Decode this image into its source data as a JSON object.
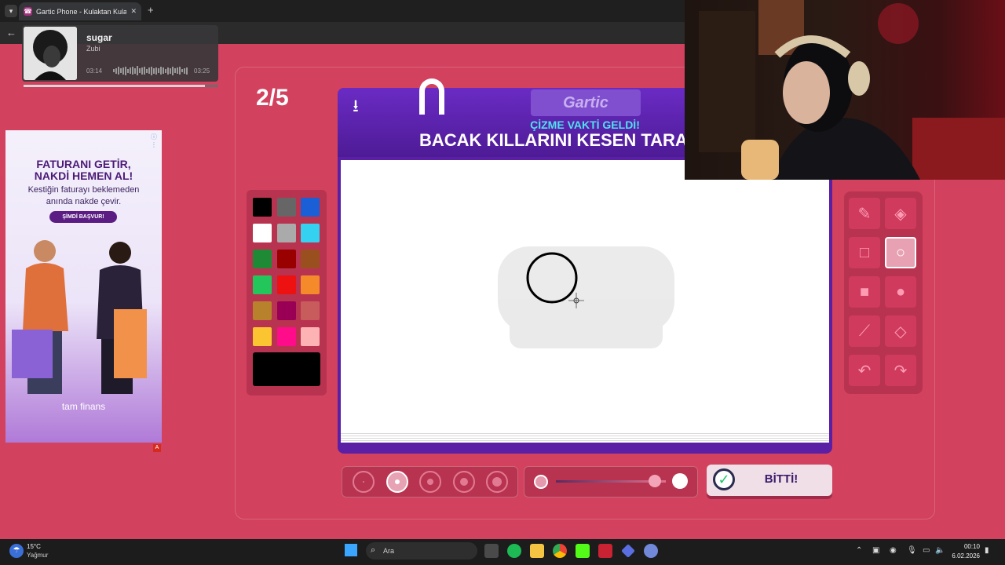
{
  "browser": {
    "tab_title": "Gartic Phone - Kulaktan Kulağa",
    "new_tab_icon": "+",
    "close_icon": "✕"
  },
  "music": {
    "title": "sugar",
    "artist": "Zubi",
    "current_time": "03:14",
    "total_time": "03:25",
    "progress": 0.93
  },
  "ad": {
    "headline": "FATURANI GETİR,\nNAKDİ HEMEN AL!",
    "subtext": "Kestiğin faturayı beklemeden\nanında nakde çevir.",
    "cta": "ŞİMDİ BAŞVUR!",
    "brand": "tam finans",
    "corner_badge": "A"
  },
  "game": {
    "round": "2/5",
    "logo": "Gartic",
    "instruction": "ÇİZME VAKTİ GELDİ!",
    "prompt": "BACAK KILLARINI KESEN TARA",
    "done_label": "BİTTİ!",
    "selected_color": "#000000",
    "selected_tool": "ellipse",
    "selected_size": 2,
    "opacity": 0.9,
    "palette": [
      "#000000",
      "#666666",
      "#1a5fd6",
      "#ffffff",
      "#aaaaaa",
      "#34d1f0",
      "#1e8a35",
      "#990000",
      "#9a4f1f",
      "#22c65a",
      "#ee1111",
      "#f58a2a",
      "#b7822b",
      "#990055",
      "#c85c5c",
      "#fbc531",
      "#ff0c8a",
      "#fdb3b3"
    ],
    "tools": [
      {
        "name": "pencil",
        "icon": "pencil-icon",
        "glyph": "✎"
      },
      {
        "name": "eraser",
        "icon": "eraser-icon",
        "glyph": "◈"
      },
      {
        "name": "rectangle-outline",
        "icon": "square-outline-icon",
        "glyph": "□"
      },
      {
        "name": "ellipse-outline",
        "icon": "circle-outline-icon",
        "glyph": "○"
      },
      {
        "name": "rectangle-filled",
        "icon": "square-filled-icon",
        "glyph": "■"
      },
      {
        "name": "ellipse-filled",
        "icon": "circle-filled-icon",
        "glyph": "●"
      },
      {
        "name": "line",
        "icon": "line-icon",
        "glyph": "⟋"
      },
      {
        "name": "fill",
        "icon": "fill-bucket-icon",
        "glyph": "◇"
      },
      {
        "name": "undo",
        "icon": "undo-icon",
        "glyph": "↶"
      },
      {
        "name": "redo",
        "icon": "redo-icon",
        "glyph": "↷"
      }
    ]
  },
  "taskbar": {
    "weather_temp": "15°C",
    "weather_desc": "Yağmur",
    "search_label": "Ara",
    "time": "00:10",
    "date": "6.02.2026"
  }
}
